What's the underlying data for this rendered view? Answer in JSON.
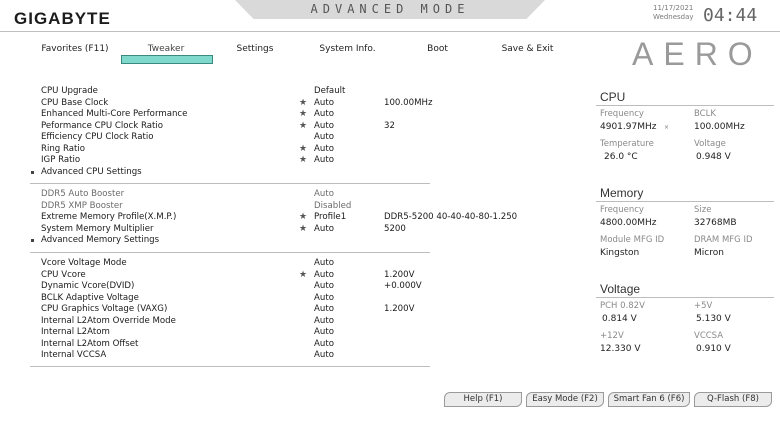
{
  "header": {
    "logo": "GIGABYTE",
    "mode_title": "ADVANCED MODE",
    "date": "11/17/2021",
    "weekday": "Wednesday",
    "time": "04:44",
    "brand": "AERO"
  },
  "tabs": [
    {
      "label": "Favorites (F11)"
    },
    {
      "label": "Tweaker",
      "active": true
    },
    {
      "label": "Settings"
    },
    {
      "label": "System Info."
    },
    {
      "label": "Boot"
    },
    {
      "label": "Save & Exit"
    }
  ],
  "settings": {
    "cpu_group": [
      {
        "label": "CPU Upgrade",
        "value": "Default",
        "extra": "",
        "star": false
      },
      {
        "label": "CPU Base Clock",
        "value": "Auto",
        "extra": "100.00MHz",
        "star": true
      },
      {
        "label": "Enhanced Multi-Core Performance",
        "value": "Auto",
        "extra": "",
        "star": true
      },
      {
        "label": "Peformance CPU Clock Ratio",
        "value": "Auto",
        "extra": "32",
        "star": true
      },
      {
        "label": "Efficiency CPU Clock Ratio",
        "value": "Auto",
        "extra": "",
        "star": false
      },
      {
        "label": "Ring Ratio",
        "value": "Auto",
        "extra": "",
        "star": true
      },
      {
        "label": "IGP Ratio",
        "value": "Auto",
        "extra": "",
        "star": true
      },
      {
        "label": "Advanced CPU Settings",
        "value": "",
        "extra": "",
        "star": false,
        "submenu": true
      }
    ],
    "memory_group": [
      {
        "label": "DDR5 Auto Booster",
        "value": "Auto",
        "extra": "",
        "star": false,
        "dim": true
      },
      {
        "label": "DDR5 XMP Booster",
        "value": "Disabled",
        "extra": "",
        "star": false,
        "dim": true
      },
      {
        "label": "Extreme Memory Profile(X.M.P.)",
        "value": "Profile1",
        "extra": "DDR5-5200 40-40-40-80-1.250",
        "star": true
      },
      {
        "label": "System Memory Multiplier",
        "value": "Auto",
        "extra": "5200",
        "star": true
      },
      {
        "label": "Advanced Memory Settings",
        "value": "",
        "extra": "",
        "star": false,
        "submenu": true
      }
    ],
    "voltage_group": [
      {
        "label": "Vcore Voltage Mode",
        "value": "Auto",
        "extra": "",
        "star": false
      },
      {
        "label": "CPU Vcore",
        "value": "Auto",
        "extra": "1.200V",
        "star": true
      },
      {
        "label": "Dynamic Vcore(DVID)",
        "value": "Auto",
        "extra": "+0.000V",
        "star": false
      },
      {
        "label": "BCLK Adaptive Voltage",
        "value": "Auto",
        "extra": "",
        "star": false
      },
      {
        "label": "CPU Graphics Voltage (VAXG)",
        "value": "Auto",
        "extra": "1.200V",
        "star": false
      },
      {
        "label": "Internal L2Atom Override Mode",
        "value": "Auto",
        "extra": "",
        "star": false
      },
      {
        "label": "Internal L2Atom",
        "value": "Auto",
        "extra": "",
        "star": false
      },
      {
        "label": "Internal L2Atom Offset",
        "value": "Auto",
        "extra": "",
        "star": false
      },
      {
        "label": "Internal VCCSA",
        "value": "Auto",
        "extra": "",
        "star": false
      }
    ]
  },
  "panel": {
    "cpu": {
      "title": "CPU",
      "frequency_label": "Frequency",
      "frequency_value": "4901.97MHz",
      "bclk_label": "BCLK",
      "bclk_value": "100.00MHz",
      "temp_label": "Temperature",
      "temp_value": "26.0 °C",
      "voltage_label": "Voltage",
      "voltage_value": "0.948 V"
    },
    "memory": {
      "title": "Memory",
      "frequency_label": "Frequency",
      "frequency_value": "4800.00MHz",
      "size_label": "Size",
      "size_value": "32768MB",
      "module_label": "Module MFG ID",
      "module_value": "Kingston",
      "dram_label": "DRAM MFG ID",
      "dram_value": "Micron"
    },
    "voltage": {
      "title": "Voltage",
      "pch_label": "PCH 0.82V",
      "pch_value": "0.814 V",
      "p5v_label": "+5V",
      "p5v_value": "5.130 V",
      "p12v_label": "+12V",
      "p12v_value": "12.330 V",
      "vccsa_label": "VCCSA",
      "vccsa_value": "0.910 V"
    }
  },
  "buttons": {
    "help": "Help (F1)",
    "easy": "Easy Mode (F2)",
    "fan": "Smart Fan 6 (F6)",
    "qflash": "Q-Flash (F8)"
  },
  "icons": {
    "favorite": "star-icon",
    "submenu": "square-bullet-icon"
  },
  "colors": {
    "tab_highlight": "#7fd8cc",
    "accent_border": "#3a8a80"
  }
}
